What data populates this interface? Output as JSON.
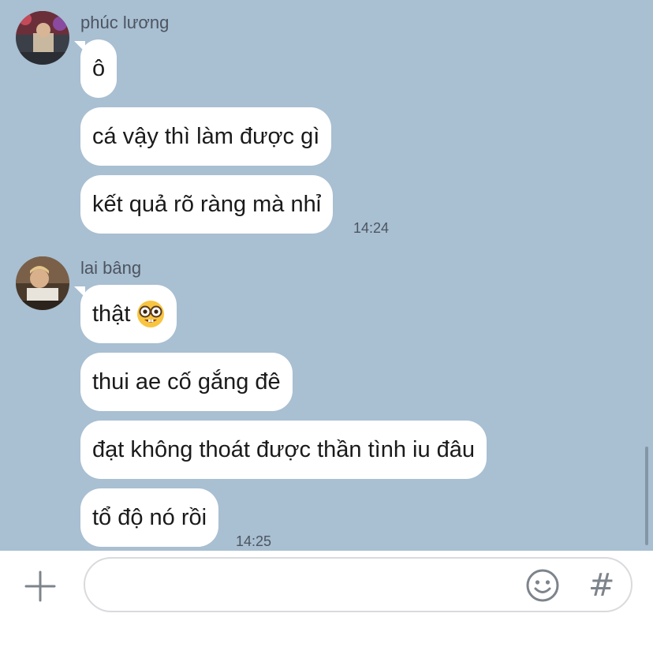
{
  "messages": [
    {
      "sender": "phúc lương",
      "bubbles": [
        "ô",
        "cá vậy thì làm được gì",
        "kết quả rõ ràng mà nhỉ"
      ],
      "time": "14:24"
    },
    {
      "sender": "lai bâng",
      "bubbles": [
        "thật",
        "thui ae cố gắng đê",
        "đạt không thoát được thần tình iu đâu",
        "tổ độ nó rồi"
      ],
      "time": "14:25"
    }
  ],
  "emoji": "nerd-face",
  "composer": {
    "plus_icon": "plus-icon",
    "emoji_icon": "smiley-icon",
    "hash_label": "#"
  }
}
